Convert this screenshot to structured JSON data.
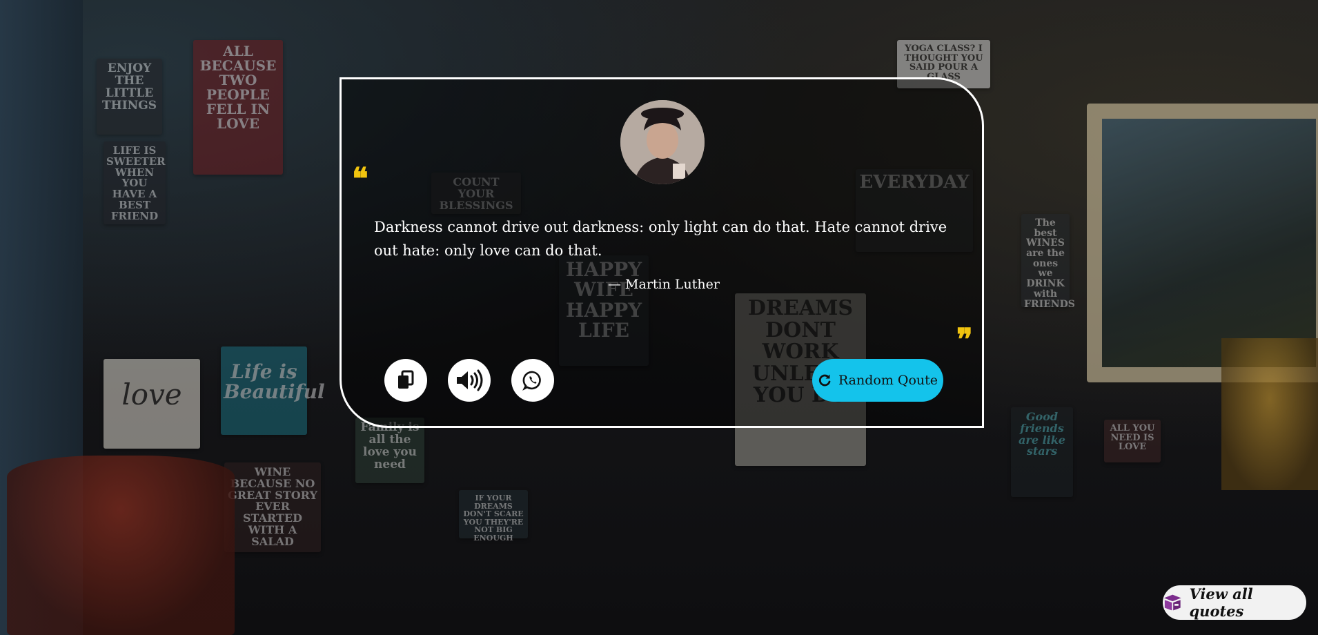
{
  "quote": {
    "text": "Darkness cannot drive out darkness: only light can do that. Hate cannot drive out hate: only love can do that.",
    "author": "— Martin Luther"
  },
  "actions": {
    "random_label": "Random Qoute",
    "view_all_label": "View all quotes"
  },
  "background_signs": [
    "ENJOY THE LITTLE THINGS",
    "LIFE IS SWEETER WHEN YOU HAVE A BEST FRIEND",
    "ALL BECAUSE TWO PEOPLE FELL IN LOVE",
    "COUNT YOUR BLESSINGS",
    "HAPPY WIFE HAPPY LIFE",
    "DREAMS DONT WORK UNLESS YOU DO",
    "EVERYDAY",
    "YOGA CLASS? I THOUGHT YOU SAID POUR A GLASS",
    "WINE BECAUSE NO GREAT STORY EVER STARTED WITH A SALAD",
    "love",
    "Life is Beautiful",
    "Family is all the love you need",
    "IF YOUR DREAMS DON'T SCARE YOU THEY'RE NOT BIG ENOUGH",
    "The best WINES are the ones we DRINK with FRIENDS",
    "Good friends are like stars",
    "ALL YOU NEED IS LOVE"
  ],
  "colors": {
    "accent": "#14c3eb",
    "quote_mark": "#f1c40f",
    "card_border": "#ffffff"
  },
  "icons": [
    "copy-icon",
    "speaker-icon",
    "whatsapp-icon",
    "refresh-icon",
    "box-icon"
  ]
}
